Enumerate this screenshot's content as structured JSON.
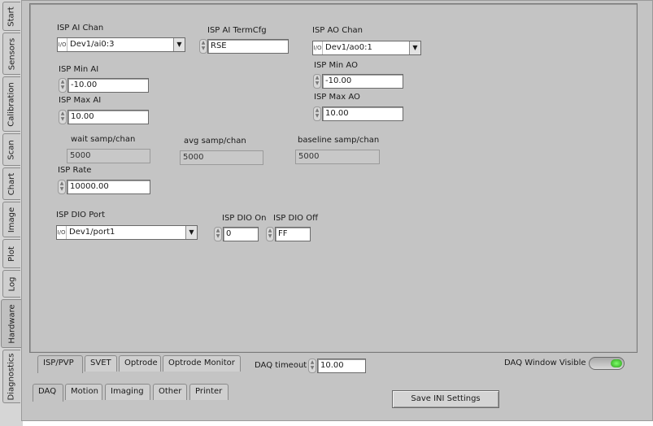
{
  "vtabs": [
    "Start",
    "Sensors",
    "Calibration",
    "Scan",
    "Chart",
    "Image",
    "Plot",
    "Log",
    "Hardware",
    "Diagnostics"
  ],
  "isp": {
    "ai_chan_label": "ISP AI Chan",
    "ai_chan_value": "Dev1/ai0:3",
    "ai_termcfg_label": "ISP AI TermCfg",
    "ai_termcfg_value": "RSE",
    "ao_chan_label": "ISP AO Chan",
    "ao_chan_value": "Dev1/ao0:1",
    "min_ai_label": "ISP Min AI",
    "min_ai_value": "-10.00",
    "max_ai_label": "ISP Max AI",
    "max_ai_value": "10.00",
    "min_ao_label": "ISP Min AO",
    "min_ao_value": "-10.00",
    "max_ao_label": "ISP Max AO",
    "max_ao_value": "10.00",
    "wait_samp_label": "wait samp/chan",
    "wait_samp_value": "5000",
    "avg_samp_label": "avg samp/chan",
    "avg_samp_value": "5000",
    "baseline_samp_label": "baseline samp/chan",
    "baseline_samp_value": "5000",
    "rate_label": "ISP Rate",
    "rate_value": "10000.00",
    "dio_port_label": "ISP DIO Port",
    "dio_port_value": "Dev1/port1",
    "dio_on_label": "ISP DIO On",
    "dio_on_value": "0",
    "dio_off_label": "ISP DIO Off",
    "dio_off_value": "FF"
  },
  "inner_tabs": [
    "ISP/PVP",
    "SVET",
    "Optrode",
    "Optrode Monitor"
  ],
  "daq_timeout_label": "DAQ timeout",
  "daq_timeout_value": "10.00",
  "daq_window_label": "DAQ Window Visible",
  "daq_window_on": true,
  "bottom_tabs": [
    "DAQ",
    "Motion",
    "Imaging",
    "Other",
    "Printer"
  ],
  "save_ini_label": "Save INI Settings",
  "colors": {
    "led_on": "#3fd12a",
    "panel": "#c4c4c4"
  }
}
